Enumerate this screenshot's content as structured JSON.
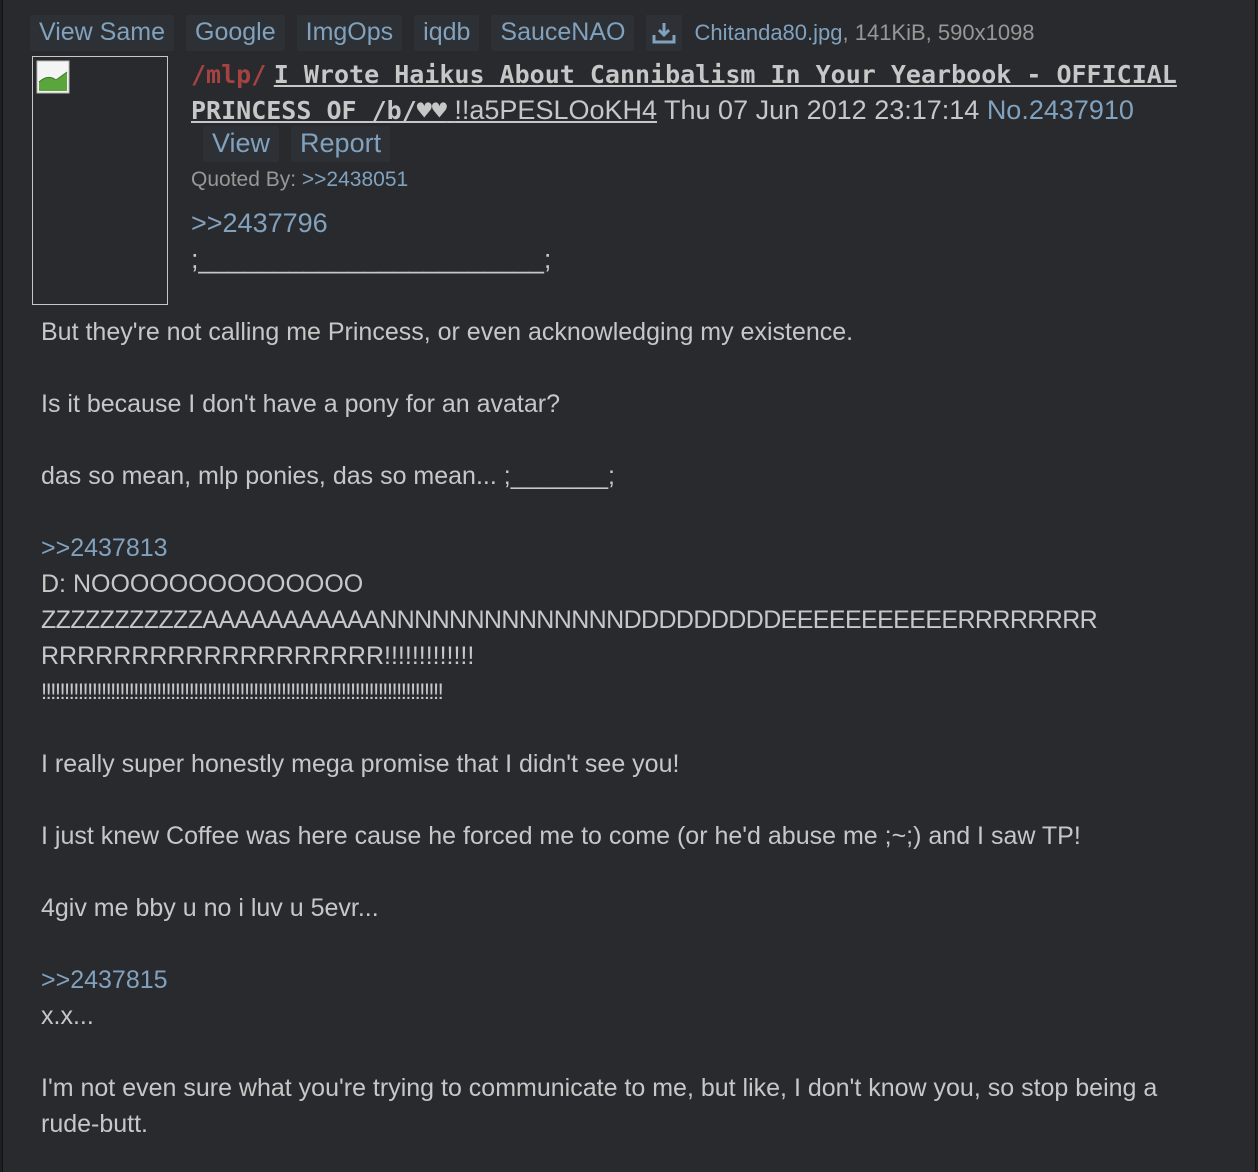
{
  "file_bar": {
    "buttons": [
      "View Same",
      "Google",
      "ImgOps",
      "iqdb",
      "SauceNAO"
    ],
    "download_icon": "download-icon",
    "file_name": "Chitanda80.jpg",
    "file_meta": ", 141KiB, 590x1098"
  },
  "header": {
    "board": "/mlp/",
    "subject": "I Wrote Haikus About Cannibalism In Your Yearbook - OFFICIAL",
    "name": "PRINCESS OF /b/♥♥",
    "tripcode": "!!a5PESLOoKH4",
    "date": "Thu 07 Jun 2012 23:17:14",
    "post_number": "No.2437910"
  },
  "actions": {
    "view": "View",
    "report": "Report"
  },
  "quoted_by": {
    "label": "Quoted By:",
    "link": ">>2438051"
  },
  "body": {
    "quote1": ">>2437796",
    "line1": ";_______________________;",
    "line2": "But they're not calling me Princess, or even acknowledging my existence.",
    "line3": "Is it because I don't have a pony for an avatar?",
    "line4": "das so mean, mlp ponies, das so mean... ;_______;",
    "quote2": ">>2437813",
    "line5": "D: NOOOOOOOOOOOOOO",
    "line6": "ZZZZZZZZZZZAAAAAAAAAAANNNNNNNNNNNNNNDDDDDDDDDEEEEEEEEEEERRRRRRRR",
    "line7": "RRRRRRRRRRRRRRRRRRR!!!!!!!!!!!!!",
    "line8": "!!!!!!!!!!!!!!!!!!!!!!!!!!!!!!!!!!!!!!!!!!!!!!!!!!!!!!!!!!!!!!!!!!!!!!!!!!!!!!!!!!!!!!!",
    "line9": "I really super honestly mega promise that I didn't see you!",
    "line10": "I just knew Coffee was here cause he forced me to come (or he'd abuse me ;~;) and I saw TP!",
    "line11": "4giv me bby u no i luv u 5evr...",
    "quote3": ">>2437815",
    "line12": "x.x...",
    "line13": "I'm not even sure what you're trying to communicate to me, but like, I don't know you, so stop being a rude-butt."
  },
  "colors": {
    "background": "#282a2e",
    "link": "#81a2be",
    "board": "#a54242",
    "text": "#c5c8c6"
  }
}
